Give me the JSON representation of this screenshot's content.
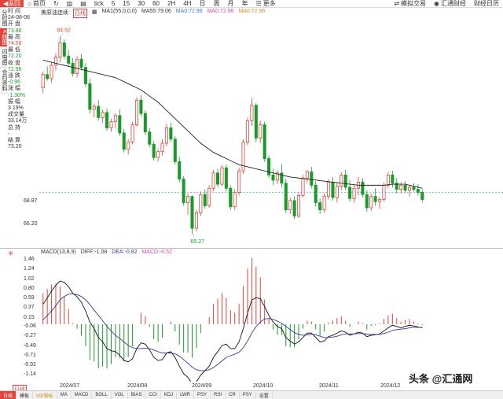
{
  "toolbar": {
    "back": "返回",
    "home": "首页",
    "refresh": "",
    "period_minute": "分",
    "period_min_tick": "tick",
    "periods": [
      "5",
      "15",
      "30",
      "60",
      "2H",
      "4H",
      "日",
      "周",
      "月",
      "年"
    ],
    "more": "更多",
    "sim_trade": "模拟交易",
    "huitong": "汇通财经",
    "calendar": "财经日历"
  },
  "left_tabs": [
    "分时图",
    "K线图",
    "闪电图",
    "合约资料"
  ],
  "info_panel": {
    "time_label": "时 间",
    "time_value": "24-08-06",
    "open_label": "开 盘",
    "open_value": "73.86",
    "high_label": "最 高",
    "high_value": "74.56",
    "low_label": "最 低",
    "low_value": "72.20",
    "close_label": "收 盘",
    "close_value": "72.96",
    "change_label": "涨 跌",
    "change_value": "-0.96",
    "pct_label": "涨 幅",
    "pct_value": "-1.30%",
    "amp_label": "振 幅",
    "amp_value": "3.19%",
    "vol_label": "成交量",
    "vol_value": "33.14万",
    "hold_label": "总 持",
    "hold_value": "-",
    "settle_label": "结 算",
    "settle_value": "73.20"
  },
  "ma_legend": {
    "title": "美原油连续",
    "tag": "日线",
    "ma1": "MA1(55,0,0,0)",
    "ma55": "MA55:79.06",
    "ma0a": "MA0:72.96",
    "ma0b": "MA0:72.96",
    "ma0c": "MA0:72.96"
  },
  "macd_legend": {
    "title": "MACD(13,8,9)",
    "diff": "DIFF:-1.08",
    "dea": "DEA:-0.82",
    "macd": "MACD:-0.52"
  },
  "price_axis": [
    "68.87",
    "66.20"
  ],
  "macd_axis": [
    "1.46",
    "1.24",
    "1.02",
    "0.80",
    "0.59",
    "0.37",
    "0.15",
    "-0.06",
    "-0.27",
    "-0.49",
    "-0.71",
    "-0.92",
    "-1.14"
  ],
  "annotations": {
    "high_mark": "84.52",
    "low_mark": "65.27"
  },
  "x_axis": [
    "2024/07",
    "2024/08",
    "2024/09",
    "2024/10",
    "2024/11",
    "2024/12"
  ],
  "bottom_tabs": [
    "日线",
    "模板",
    "VIP指标",
    "MA",
    "MACD",
    "BOLL",
    "VOL",
    "BIAS",
    "CCI",
    "KDJ",
    "LWR",
    "PSY",
    "RSI",
    "CR",
    "PSY",
    "设置"
  ],
  "watermark": {
    "prefix": "头条",
    "text": "@汇通网"
  },
  "colors": {
    "up": "#e0443a",
    "down": "#1a9a2c",
    "ma": "#222222",
    "dea": "#3a3aa0",
    "bg": "#ffffff"
  },
  "chart_data": {
    "type": "candlestick",
    "price_range": [
      64.5,
      86
    ],
    "candles": [
      [
        79.5,
        81.1,
        79.0,
        80.8
      ],
      [
        80.8,
        81.6,
        80.2,
        80.4
      ],
      [
        80.4,
        82.0,
        80.0,
        81.7
      ],
      [
        81.7,
        82.9,
        81.2,
        82.5
      ],
      [
        82.5,
        84.52,
        82.0,
        83.9
      ],
      [
        83.9,
        84.2,
        82.3,
        82.6
      ],
      [
        82.6,
        83.2,
        81.6,
        81.9
      ],
      [
        81.9,
        82.4,
        80.6,
        80.9
      ],
      [
        80.9,
        82.6,
        80.5,
        82.3
      ],
      [
        82.3,
        82.8,
        81.2,
        81.5
      ],
      [
        81.5,
        81.9,
        79.6,
        79.9
      ],
      [
        79.9,
        80.4,
        77.0,
        77.4
      ],
      [
        77.4,
        78.0,
        76.6,
        77.7
      ],
      [
        77.7,
        78.3,
        76.3,
        76.6
      ],
      [
        76.6,
        77.4,
        76.1,
        77.1
      ],
      [
        77.1,
        77.5,
        75.3,
        75.6
      ],
      [
        75.6,
        76.5,
        75.2,
        76.2
      ],
      [
        76.2,
        77.0,
        75.6,
        76.8
      ],
      [
        76.8,
        77.4,
        74.8,
        75.1
      ],
      [
        75.1,
        75.5,
        73.2,
        73.5
      ],
      [
        73.5,
        74.5,
        73.0,
        74.2
      ],
      [
        74.2,
        76.2,
        74.0,
        75.9
      ],
      [
        75.9,
        78.6,
        75.7,
        78.3
      ],
      [
        78.3,
        78.8,
        76.7,
        77.0
      ],
      [
        77.0,
        77.3,
        74.9,
        75.2
      ],
      [
        75.2,
        75.6,
        73.7,
        74.0
      ],
      [
        74.0,
        74.3,
        72.4,
        72.7
      ],
      [
        72.7,
        73.6,
        72.3,
        73.3
      ],
      [
        73.3,
        74.5,
        72.9,
        74.1
      ],
      [
        74.1,
        76.0,
        73.8,
        75.6
      ],
      [
        75.6,
        76.1,
        74.2,
        74.5
      ],
      [
        74.5,
        74.8,
        72.0,
        72.3
      ],
      [
        72.3,
        72.8,
        70.3,
        70.6
      ],
      [
        70.6,
        70.9,
        68.0,
        68.3
      ],
      [
        68.3,
        69.2,
        67.1,
        68.9
      ],
      [
        68.9,
        69.0,
        65.27,
        65.8
      ],
      [
        65.8,
        67.6,
        65.5,
        67.3
      ],
      [
        67.3,
        69.4,
        67.0,
        69.1
      ],
      [
        69.1,
        69.6,
        67.7,
        68.0
      ],
      [
        68.0,
        70.0,
        67.8,
        69.7
      ],
      [
        69.7,
        71.5,
        69.4,
        71.2
      ],
      [
        71.2,
        71.6,
        69.8,
        70.1
      ],
      [
        70.1,
        72.0,
        69.9,
        71.7
      ],
      [
        71.7,
        72.0,
        69.4,
        69.7
      ],
      [
        69.7,
        70.0,
        67.6,
        67.9
      ],
      [
        67.9,
        69.6,
        67.6,
        69.3
      ],
      [
        69.3,
        71.7,
        69.0,
        71.4
      ],
      [
        71.4,
        74.5,
        71.1,
        74.2
      ],
      [
        74.2,
        76.6,
        73.9,
        76.3
      ],
      [
        76.3,
        78.5,
        75.8,
        77.8
      ],
      [
        77.8,
        78.0,
        74.2,
        74.6
      ],
      [
        74.6,
        76.3,
        74.1,
        75.9
      ],
      [
        75.9,
        76.2,
        72.3,
        72.6
      ],
      [
        72.6,
        72.9,
        70.7,
        71.0
      ],
      [
        71.0,
        71.6,
        70.0,
        70.5
      ],
      [
        70.5,
        71.5,
        70.1,
        71.2
      ],
      [
        71.2,
        72.1,
        69.8,
        70.2
      ],
      [
        70.2,
        70.6,
        67.3,
        67.6
      ],
      [
        67.6,
        68.8,
        67.2,
        68.5
      ],
      [
        68.5,
        68.9,
        66.7,
        67.0
      ],
      [
        67.0,
        69.3,
        66.8,
        69.0
      ],
      [
        69.0,
        71.0,
        68.8,
        70.7
      ],
      [
        70.7,
        71.5,
        70.2,
        71.3
      ],
      [
        71.3,
        71.8,
        69.7,
        70.0
      ],
      [
        70.0,
        70.4,
        67.9,
        68.3
      ],
      [
        68.3,
        68.7,
        67.2,
        67.6
      ],
      [
        67.6,
        69.2,
        67.3,
        68.9
      ],
      [
        68.9,
        70.6,
        68.6,
        70.3
      ],
      [
        70.3,
        70.8,
        68.5,
        68.8
      ],
      [
        68.8,
        70.2,
        68.3,
        69.9
      ],
      [
        69.9,
        71.3,
        69.5,
        71.0
      ],
      [
        71.0,
        71.5,
        69.5,
        69.8
      ],
      [
        69.8,
        70.5,
        68.4,
        68.7
      ],
      [
        68.7,
        70.0,
        68.3,
        69.7
      ],
      [
        69.7,
        70.8,
        69.0,
        70.3
      ],
      [
        70.3,
        70.7,
        68.8,
        69.1
      ],
      [
        69.1,
        69.5,
        67.4,
        67.8
      ],
      [
        67.8,
        69.2,
        67.5,
        68.9
      ],
      [
        68.9,
        69.7,
        68.0,
        68.4
      ],
      [
        68.4,
        68.9,
        67.7,
        68.6
      ],
      [
        68.6,
        70.3,
        68.4,
        70.0
      ],
      [
        70.0,
        71.3,
        69.7,
        71.0
      ],
      [
        71.0,
        71.4,
        69.8,
        70.2
      ],
      [
        70.2,
        70.7,
        69.2,
        69.6
      ],
      [
        69.6,
        70.3,
        69.2,
        70.0
      ],
      [
        70.0,
        70.4,
        69.3,
        69.5
      ],
      [
        69.5,
        70.0,
        68.9,
        69.8
      ],
      [
        69.8,
        70.2,
        69.4,
        69.6
      ],
      [
        69.6,
        70.1,
        69.0,
        69.3
      ],
      [
        69.3,
        69.6,
        68.3,
        68.6
      ]
    ],
    "ma55": [
      82.2,
      82.1,
      82.0,
      81.9,
      81.8,
      81.7,
      81.6,
      81.5,
      81.4,
      81.3,
      81.2,
      81.1,
      81.0,
      80.9,
      80.8,
      80.7,
      80.6,
      80.5,
      80.3,
      80.1,
      79.9,
      79.7,
      79.5,
      79.3,
      79.0,
      78.7,
      78.4,
      78.1,
      77.7,
      77.3,
      76.9,
      76.5,
      76.1,
      75.7,
      75.3,
      74.9,
      74.5,
      74.1,
      73.8,
      73.5,
      73.2,
      73.0,
      72.8,
      72.6,
      72.4,
      72.2,
      72.0,
      71.9,
      71.8,
      71.7,
      71.6,
      71.5,
      71.4,
      71.3,
      71.2,
      71.1,
      71.0,
      70.9,
      70.8,
      70.75,
      70.7,
      70.65,
      70.6,
      70.55,
      70.5,
      70.45,
      70.4,
      70.35,
      70.3,
      70.25,
      70.2,
      70.15,
      70.1,
      70.05,
      70.0,
      70.0,
      70.0,
      70.0,
      70.0,
      70.0,
      70.0,
      70.05,
      70.1,
      70.1,
      70.1,
      70.1,
      70.0,
      69.9,
      69.8,
      69.7
    ],
    "macd_range": [
      -1.3,
      1.55
    ],
    "diff": [
      0.45,
      0.6,
      0.75,
      0.88,
      0.98,
      0.95,
      0.85,
      0.7,
      0.62,
      0.5,
      0.3,
      0.05,
      -0.1,
      -0.3,
      -0.4,
      -0.55,
      -0.6,
      -0.62,
      -0.7,
      -0.82,
      -0.85,
      -0.78,
      -0.55,
      -0.42,
      -0.45,
      -0.58,
      -0.75,
      -0.82,
      -0.8,
      -0.65,
      -0.62,
      -0.75,
      -0.95,
      -1.12,
      -1.2,
      -1.35,
      -1.3,
      -1.15,
      -1.05,
      -0.95,
      -0.75,
      -0.62,
      -0.48,
      -0.45,
      -0.55,
      -0.55,
      -0.4,
      -0.1,
      0.25,
      0.55,
      0.6,
      0.58,
      0.4,
      0.2,
      0.05,
      -0.05,
      -0.1,
      -0.3,
      -0.38,
      -0.45,
      -0.4,
      -0.3,
      -0.2,
      -0.2,
      -0.3,
      -0.4,
      -0.38,
      -0.28,
      -0.25,
      -0.2,
      -0.15,
      -0.18,
      -0.25,
      -0.22,
      -0.18,
      -0.2,
      -0.28,
      -0.25,
      -0.24,
      -0.22,
      -0.15,
      -0.08,
      -0.02,
      -0.05,
      -0.08,
      -0.05,
      -0.02,
      -0.04,
      -0.06,
      -0.08
    ],
    "dea": [
      0.1,
      0.2,
      0.3,
      0.42,
      0.55,
      0.63,
      0.68,
      0.69,
      0.67,
      0.63,
      0.55,
      0.45,
      0.32,
      0.2,
      0.08,
      -0.05,
      -0.15,
      -0.25,
      -0.32,
      -0.4,
      -0.48,
      -0.53,
      -0.55,
      -0.55,
      -0.54,
      -0.55,
      -0.58,
      -0.62,
      -0.65,
      -0.65,
      -0.65,
      -0.67,
      -0.72,
      -0.8,
      -0.88,
      -0.97,
      -1.03,
      -1.05,
      -1.05,
      -1.03,
      -0.98,
      -0.91,
      -0.83,
      -0.75,
      -0.71,
      -0.68,
      -0.63,
      -0.53,
      -0.38,
      -0.2,
      -0.05,
      0.05,
      0.12,
      0.13,
      0.11,
      0.07,
      0.02,
      -0.05,
      -0.12,
      -0.19,
      -0.23,
      -0.25,
      -0.24,
      -0.23,
      -0.24,
      -0.27,
      -0.3,
      -0.3,
      -0.29,
      -0.27,
      -0.24,
      -0.22,
      -0.22,
      -0.22,
      -0.21,
      -0.21,
      -0.22,
      -0.23,
      -0.23,
      -0.23,
      -0.21,
      -0.18,
      -0.14,
      -0.12,
      -0.11,
      -0.1,
      -0.08,
      -0.07,
      -0.07,
      -0.07
    ]
  }
}
